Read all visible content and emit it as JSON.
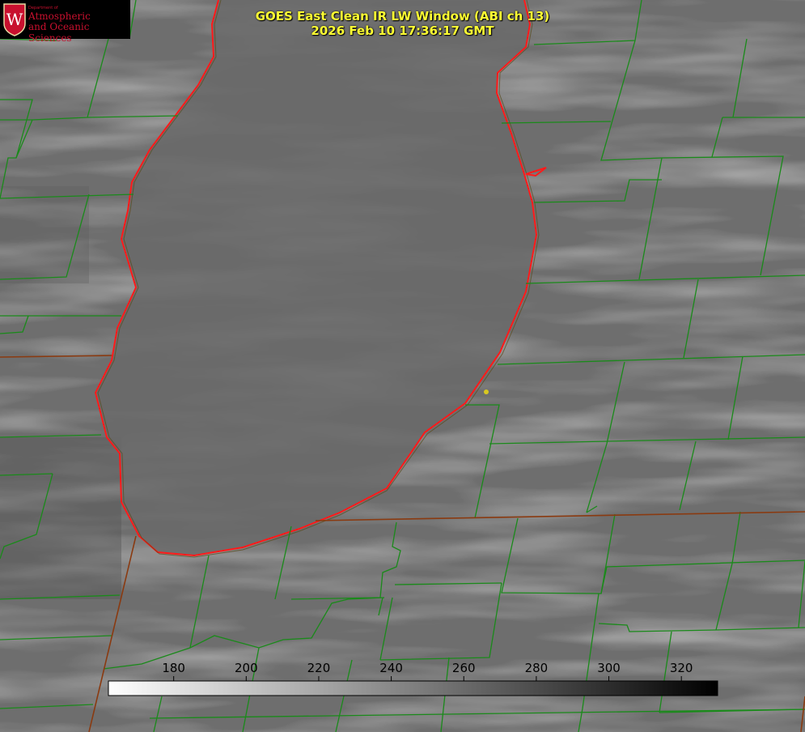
{
  "header": {
    "title": "GOES East Clean IR LW Window (ABI ch 13)",
    "timestamp": "2026 Feb 10 17:36:17 GMT"
  },
  "logo": {
    "small_text": "Department of",
    "line1": "Atmospheric",
    "line2": "and Oceanic Sciences",
    "crest_letter": "W"
  },
  "colorbar": {
    "ticks": [
      "180",
      "200",
      "220",
      "240",
      "260",
      "280",
      "300",
      "320"
    ],
    "min_value": 162,
    "max_value": 330
  },
  "colors": {
    "title": "#ffff33",
    "county_lines": "#1a8a1a",
    "state_lines": "#8a3a10",
    "lake_outline": "#ff1a1a",
    "marker": "#d8c820",
    "logo_text": "#c8102e"
  }
}
